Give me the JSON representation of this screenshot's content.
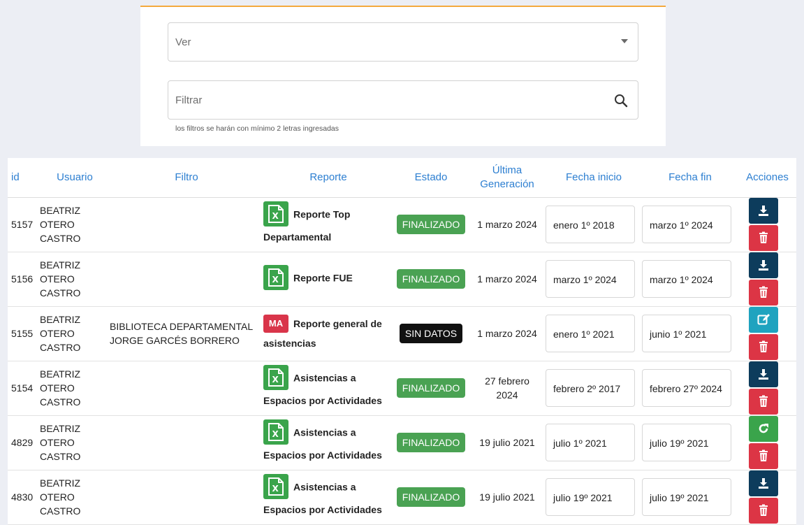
{
  "filter": {
    "select_placeholder": "Ver",
    "search_placeholder": "Filtrar",
    "hint": "los filtros se harán con mínimo 2 letras ingresadas"
  },
  "table": {
    "headers": {
      "id": "id",
      "usuario": "Usuario",
      "filtro": "Filtro",
      "reporte": "Reporte",
      "estado": "Estado",
      "ultima_1": "Última",
      "ultima_2": "Generación",
      "fecha_inicio": "Fecha inicio",
      "fecha_fin": "Fecha fin",
      "acciones": "Acciones"
    },
    "rows": [
      {
        "id": "5157",
        "user": [
          "BEATRIZ",
          "OTERO",
          "CASTRO"
        ],
        "filtro": [
          "",
          ""
        ],
        "icon": "excel",
        "rep_1": "Reporte Top",
        "rep_2": "Departamental",
        "estado": "FINALIZADO",
        "estado_style": "ok",
        "ultima": [
          "1 marzo 2024",
          ""
        ],
        "fi": "enero 1º 2018",
        "ff": "marzo 1º 2024",
        "actions": [
          "download",
          "delete"
        ]
      },
      {
        "id": "5156",
        "user": [
          "BEATRIZ",
          "OTERO",
          "CASTRO"
        ],
        "filtro": [
          "",
          ""
        ],
        "icon": "excel",
        "rep_1": "Reporte FUE",
        "rep_2": "",
        "estado": "FINALIZADO",
        "estado_style": "ok",
        "ultima": [
          "1 marzo 2024",
          ""
        ],
        "fi": "marzo 1º 2024",
        "ff": "marzo 1º 2024",
        "actions": [
          "download",
          "delete"
        ]
      },
      {
        "id": "5155",
        "user": [
          "BEATRIZ",
          "OTERO",
          "CASTRO"
        ],
        "filtro": [
          "BIBLIOTECA DEPARTAMENTAL",
          "JORGE GARCÉS BORRERO"
        ],
        "icon": "MA",
        "rep_1": "Reporte general de",
        "rep_2": "asistencias",
        "estado": "SIN DATOS",
        "estado_style": "nd",
        "ultima": [
          "1 marzo 2024",
          ""
        ],
        "fi": "enero 1º 2021",
        "ff": "junio 1º 2021",
        "actions": [
          "edit",
          "delete"
        ]
      },
      {
        "id": "5154",
        "user": [
          "BEATRIZ",
          "OTERO",
          "CASTRO"
        ],
        "filtro": [
          "",
          ""
        ],
        "icon": "excel",
        "rep_1": "Asistencias a",
        "rep_2": "Espacios por Actividades",
        "estado": "FINALIZADO",
        "estado_style": "ok",
        "ultima": [
          "27 febrero",
          "2024"
        ],
        "fi": "febrero 2º 2017",
        "ff": "febrero 27º 2024",
        "actions": [
          "download",
          "delete"
        ]
      },
      {
        "id": "4829",
        "user": [
          "BEATRIZ",
          "OTERO",
          "CASTRO"
        ],
        "filtro": [
          "",
          ""
        ],
        "icon": "excel",
        "rep_1": "Asistencias a",
        "rep_2": "Espacios por Actividades",
        "estado": "FINALIZADO",
        "estado_style": "ok",
        "ultima": [
          "19 julio 2021",
          ""
        ],
        "fi": "julio 1º 2021",
        "ff": "julio 19º 2021",
        "actions": [
          "refresh",
          "delete"
        ]
      },
      {
        "id": "4830",
        "user": [
          "BEATRIZ",
          "OTERO",
          "CASTRO"
        ],
        "filtro": [
          "",
          ""
        ],
        "icon": "excel",
        "rep_1": "Asistencias a",
        "rep_2": "Espacios por Actividades",
        "estado": "FINALIZADO",
        "estado_style": "ok",
        "ultima": [
          "19 julio 2021",
          ""
        ],
        "fi": "julio 19º 2021",
        "ff": "julio 19º 2021",
        "actions": [
          "download",
          "delete"
        ]
      }
    ]
  },
  "colors": {
    "accent_border": "#f4a93d",
    "header_text": "#2d7fd1",
    "status_ok": "#4aa253",
    "status_no_data": "#111111",
    "download": "#0d3c5c",
    "delete": "#dc3545",
    "edit": "#1fa3bf",
    "refresh": "#3aa44b"
  }
}
